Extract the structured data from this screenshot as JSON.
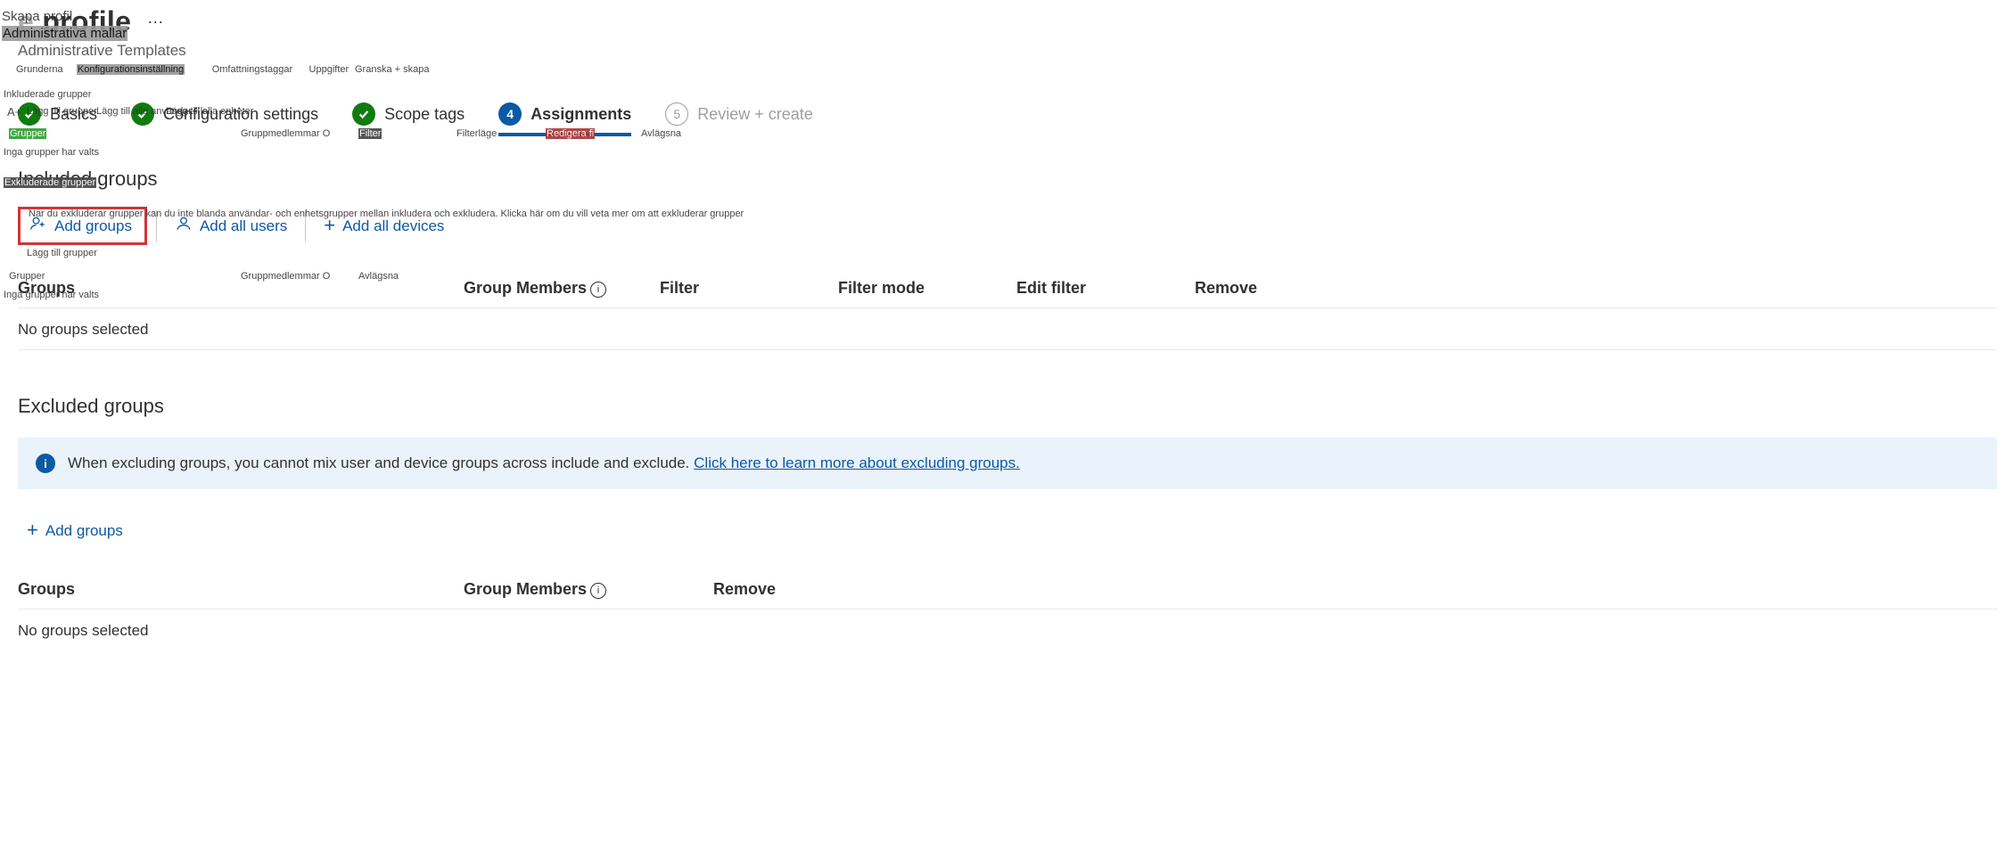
{
  "ghost_header": {
    "title": "Skapa profil",
    "sub_hl": "Administrativa mallar",
    "tabs": [
      "Grunderna",
      "Konfigurationsinställning",
      "Omfattningstaggar",
      "Uppgifter",
      "Granska + skapa"
    ],
    "included_label": "Inkluderade grupper",
    "lead_chip": "A+",
    "add_groups": "Lägg till grupper",
    "add_users": "Lägg till alla användar - k",
    "add_devices": "Lägg till alla enheter",
    "stepper_overlay": [
      "Grupper",
      "Gruppmedlemmar O",
      "Filter",
      "Filterläge",
      "Redigera fi",
      "Avlägsna"
    ],
    "no_groups": "Inga grupper har valts",
    "excluded_label": "Exkluderade grupper",
    "excluded_note": "När du exkluderar grupper kan du inte blanda användar- och enhetsgrupper mellan inkludera och exkludera. Klicka här om du vill veta mer om att exkluderar grupper",
    "add_groups2": "Lägg till grupper",
    "cols2": [
      "Grupper",
      "Gruppmedlemmar O",
      "Avlägsna"
    ],
    "no_groups2": "Inga grupper har valts"
  },
  "header": {
    "title_suffix": "profile",
    "title_prefix_obscured": "e",
    "subtitle": "Administrative Templates"
  },
  "stepper": [
    {
      "label": "Basics",
      "state": "done"
    },
    {
      "label": "Configuration settings",
      "state": "done"
    },
    {
      "label": "Scope tags",
      "state": "done"
    },
    {
      "label": "Assignments",
      "state": "active",
      "num": "4"
    },
    {
      "label": "Review + create",
      "state": "disabled",
      "num": "5"
    }
  ],
  "included": {
    "heading": "Included groups",
    "actions": {
      "add_groups": "Add groups",
      "add_all_users": "Add all users",
      "add_all_devices": "Add all devices"
    },
    "columns": [
      "Groups",
      "Group Members",
      "Filter",
      "Filter mode",
      "Edit filter",
      "Remove"
    ],
    "empty": "No groups selected"
  },
  "excluded": {
    "heading": "Excluded groups",
    "banner_text": "When excluding groups, you cannot mix user and device groups across include and exclude. ",
    "banner_link": "Click here to learn more about excluding groups.",
    "add_groups": "Add groups",
    "columns": [
      "Groups",
      "Group Members",
      "Remove"
    ],
    "empty": "No groups selected"
  }
}
